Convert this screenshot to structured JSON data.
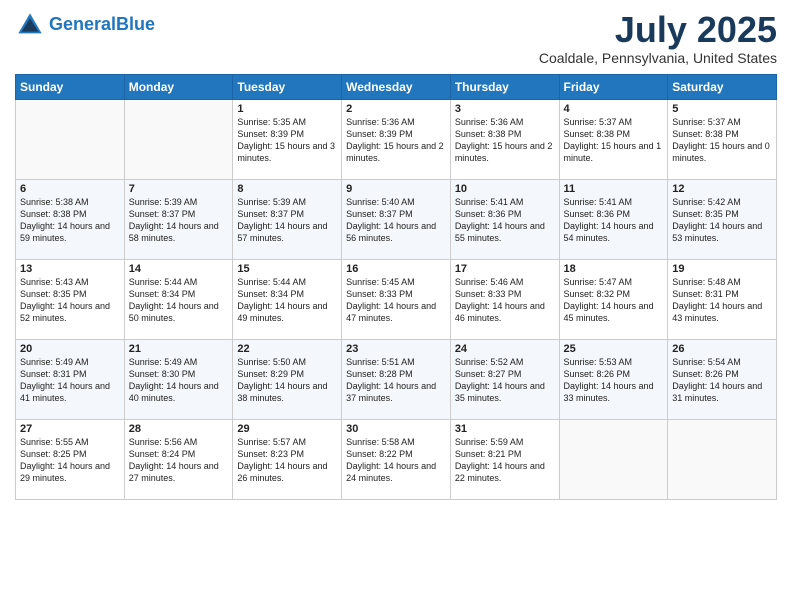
{
  "header": {
    "logo_line1": "General",
    "logo_line2": "Blue",
    "month_title": "July 2025",
    "location": "Coaldale, Pennsylvania, United States"
  },
  "days_of_week": [
    "Sunday",
    "Monday",
    "Tuesday",
    "Wednesday",
    "Thursday",
    "Friday",
    "Saturday"
  ],
  "weeks": [
    [
      {
        "day": "",
        "sunrise": "",
        "sunset": "",
        "daylight": ""
      },
      {
        "day": "",
        "sunrise": "",
        "sunset": "",
        "daylight": ""
      },
      {
        "day": "1",
        "sunrise": "Sunrise: 5:35 AM",
        "sunset": "Sunset: 8:39 PM",
        "daylight": "Daylight: 15 hours and 3 minutes."
      },
      {
        "day": "2",
        "sunrise": "Sunrise: 5:36 AM",
        "sunset": "Sunset: 8:39 PM",
        "daylight": "Daylight: 15 hours and 2 minutes."
      },
      {
        "day": "3",
        "sunrise": "Sunrise: 5:36 AM",
        "sunset": "Sunset: 8:38 PM",
        "daylight": "Daylight: 15 hours and 2 minutes."
      },
      {
        "day": "4",
        "sunrise": "Sunrise: 5:37 AM",
        "sunset": "Sunset: 8:38 PM",
        "daylight": "Daylight: 15 hours and 1 minute."
      },
      {
        "day": "5",
        "sunrise": "Sunrise: 5:37 AM",
        "sunset": "Sunset: 8:38 PM",
        "daylight": "Daylight: 15 hours and 0 minutes."
      }
    ],
    [
      {
        "day": "6",
        "sunrise": "Sunrise: 5:38 AM",
        "sunset": "Sunset: 8:38 PM",
        "daylight": "Daylight: 14 hours and 59 minutes."
      },
      {
        "day": "7",
        "sunrise": "Sunrise: 5:39 AM",
        "sunset": "Sunset: 8:37 PM",
        "daylight": "Daylight: 14 hours and 58 minutes."
      },
      {
        "day": "8",
        "sunrise": "Sunrise: 5:39 AM",
        "sunset": "Sunset: 8:37 PM",
        "daylight": "Daylight: 14 hours and 57 minutes."
      },
      {
        "day": "9",
        "sunrise": "Sunrise: 5:40 AM",
        "sunset": "Sunset: 8:37 PM",
        "daylight": "Daylight: 14 hours and 56 minutes."
      },
      {
        "day": "10",
        "sunrise": "Sunrise: 5:41 AM",
        "sunset": "Sunset: 8:36 PM",
        "daylight": "Daylight: 14 hours and 55 minutes."
      },
      {
        "day": "11",
        "sunrise": "Sunrise: 5:41 AM",
        "sunset": "Sunset: 8:36 PM",
        "daylight": "Daylight: 14 hours and 54 minutes."
      },
      {
        "day": "12",
        "sunrise": "Sunrise: 5:42 AM",
        "sunset": "Sunset: 8:35 PM",
        "daylight": "Daylight: 14 hours and 53 minutes."
      }
    ],
    [
      {
        "day": "13",
        "sunrise": "Sunrise: 5:43 AM",
        "sunset": "Sunset: 8:35 PM",
        "daylight": "Daylight: 14 hours and 52 minutes."
      },
      {
        "day": "14",
        "sunrise": "Sunrise: 5:44 AM",
        "sunset": "Sunset: 8:34 PM",
        "daylight": "Daylight: 14 hours and 50 minutes."
      },
      {
        "day": "15",
        "sunrise": "Sunrise: 5:44 AM",
        "sunset": "Sunset: 8:34 PM",
        "daylight": "Daylight: 14 hours and 49 minutes."
      },
      {
        "day": "16",
        "sunrise": "Sunrise: 5:45 AM",
        "sunset": "Sunset: 8:33 PM",
        "daylight": "Daylight: 14 hours and 47 minutes."
      },
      {
        "day": "17",
        "sunrise": "Sunrise: 5:46 AM",
        "sunset": "Sunset: 8:33 PM",
        "daylight": "Daylight: 14 hours and 46 minutes."
      },
      {
        "day": "18",
        "sunrise": "Sunrise: 5:47 AM",
        "sunset": "Sunset: 8:32 PM",
        "daylight": "Daylight: 14 hours and 45 minutes."
      },
      {
        "day": "19",
        "sunrise": "Sunrise: 5:48 AM",
        "sunset": "Sunset: 8:31 PM",
        "daylight": "Daylight: 14 hours and 43 minutes."
      }
    ],
    [
      {
        "day": "20",
        "sunrise": "Sunrise: 5:49 AM",
        "sunset": "Sunset: 8:31 PM",
        "daylight": "Daylight: 14 hours and 41 minutes."
      },
      {
        "day": "21",
        "sunrise": "Sunrise: 5:49 AM",
        "sunset": "Sunset: 8:30 PM",
        "daylight": "Daylight: 14 hours and 40 minutes."
      },
      {
        "day": "22",
        "sunrise": "Sunrise: 5:50 AM",
        "sunset": "Sunset: 8:29 PM",
        "daylight": "Daylight: 14 hours and 38 minutes."
      },
      {
        "day": "23",
        "sunrise": "Sunrise: 5:51 AM",
        "sunset": "Sunset: 8:28 PM",
        "daylight": "Daylight: 14 hours and 37 minutes."
      },
      {
        "day": "24",
        "sunrise": "Sunrise: 5:52 AM",
        "sunset": "Sunset: 8:27 PM",
        "daylight": "Daylight: 14 hours and 35 minutes."
      },
      {
        "day": "25",
        "sunrise": "Sunrise: 5:53 AM",
        "sunset": "Sunset: 8:26 PM",
        "daylight": "Daylight: 14 hours and 33 minutes."
      },
      {
        "day": "26",
        "sunrise": "Sunrise: 5:54 AM",
        "sunset": "Sunset: 8:26 PM",
        "daylight": "Daylight: 14 hours and 31 minutes."
      }
    ],
    [
      {
        "day": "27",
        "sunrise": "Sunrise: 5:55 AM",
        "sunset": "Sunset: 8:25 PM",
        "daylight": "Daylight: 14 hours and 29 minutes."
      },
      {
        "day": "28",
        "sunrise": "Sunrise: 5:56 AM",
        "sunset": "Sunset: 8:24 PM",
        "daylight": "Daylight: 14 hours and 27 minutes."
      },
      {
        "day": "29",
        "sunrise": "Sunrise: 5:57 AM",
        "sunset": "Sunset: 8:23 PM",
        "daylight": "Daylight: 14 hours and 26 minutes."
      },
      {
        "day": "30",
        "sunrise": "Sunrise: 5:58 AM",
        "sunset": "Sunset: 8:22 PM",
        "daylight": "Daylight: 14 hours and 24 minutes."
      },
      {
        "day": "31",
        "sunrise": "Sunrise: 5:59 AM",
        "sunset": "Sunset: 8:21 PM",
        "daylight": "Daylight: 14 hours and 22 minutes."
      },
      {
        "day": "",
        "sunrise": "",
        "sunset": "",
        "daylight": ""
      },
      {
        "day": "",
        "sunrise": "",
        "sunset": "",
        "daylight": ""
      }
    ]
  ]
}
